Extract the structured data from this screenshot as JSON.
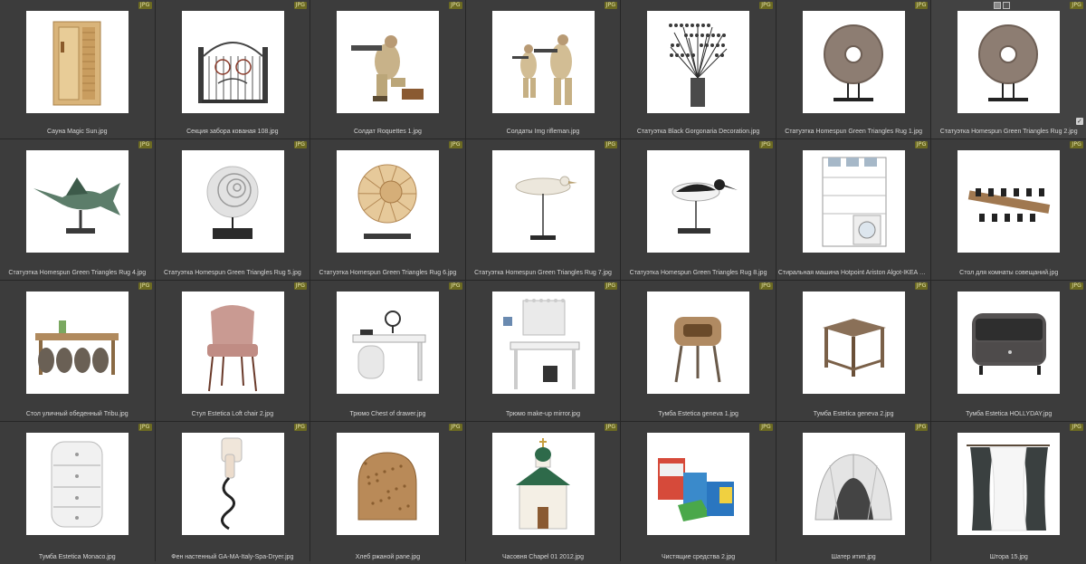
{
  "badge_label": "JPG",
  "selection": {
    "tools": [
      "square-icon",
      "pen-icon"
    ],
    "check_glyph": "✓"
  },
  "items": [
    {
      "name": "Сауна Magic Sun.jpg",
      "icon": "sauna"
    },
    {
      "name": "Секция забора кованая 108.jpg",
      "icon": "gate"
    },
    {
      "name": "Солдат Roquettes 1.jpg",
      "icon": "soldier"
    },
    {
      "name": "Солдаты Img rifleman.jpg",
      "icon": "soldiers"
    },
    {
      "name": "Статуэтка Black Gorgonaria Decoration.jpg",
      "icon": "coral"
    },
    {
      "name": "Статуэтка Homespun Green Triangles Rug 1.jpg",
      "icon": "stone-disc"
    },
    {
      "name": "Статуэтка Homespun Green Triangles Rug 2.jpg",
      "icon": "stone-disc"
    },
    {
      "name": "Статуэтка Homespun Green Triangles Rug 4.jpg",
      "icon": "marlin"
    },
    {
      "name": "Статуэтка Homespun Green Triangles Rug 5.jpg",
      "icon": "shell-white"
    },
    {
      "name": "Статуэтка Homespun Green Triangles Rug 6.jpg",
      "icon": "shell-beige"
    },
    {
      "name": "Статуэтка Homespun Green Triangles Rug 7.jpg",
      "icon": "bird-white"
    },
    {
      "name": "Статуэтка Homespun Green Triangles Rug 8.jpg",
      "icon": "bird-black"
    },
    {
      "name": "Стиральная машина Hotpoint Ariston Algot-IKEA Storag...",
      "icon": "laundry"
    },
    {
      "name": "Стол для комнаты совещаний.jpg",
      "icon": "conference"
    },
    {
      "name": "Стол уличный обеденный Tribu.jpg",
      "icon": "dining"
    },
    {
      "name": "Стул Estetica Loft chair 2.jpg",
      "icon": "chair"
    },
    {
      "name": "Трюмо Chest of drawer.jpg",
      "icon": "vanity-round"
    },
    {
      "name": "Трюмо make-up mirror.jpg",
      "icon": "vanity"
    },
    {
      "name": "Тумба Estetica geneva 1.jpg",
      "icon": "stool"
    },
    {
      "name": "Тумба Estetica geneva 2.jpg",
      "icon": "side-table"
    },
    {
      "name": "Тумба Estetica HOLLYDAY.jpg",
      "icon": "nightstand"
    },
    {
      "name": "Тумба Estetica Monaco.jpg",
      "icon": "drawers-white"
    },
    {
      "name": "Фен настенный GA-MA-Italy-Spa-Dryer.jpg",
      "icon": "dryer"
    },
    {
      "name": "Хлеб ржаной pane.jpg",
      "icon": "bread"
    },
    {
      "name": "Часовня Chapel 01 2012.jpg",
      "icon": "chapel"
    },
    {
      "name": "Чистящие средства 2.jpg",
      "icon": "detergents"
    },
    {
      "name": "Шатер итип.jpg",
      "icon": "tent"
    },
    {
      "name": "Штора 15.jpg",
      "icon": "curtain"
    }
  ]
}
